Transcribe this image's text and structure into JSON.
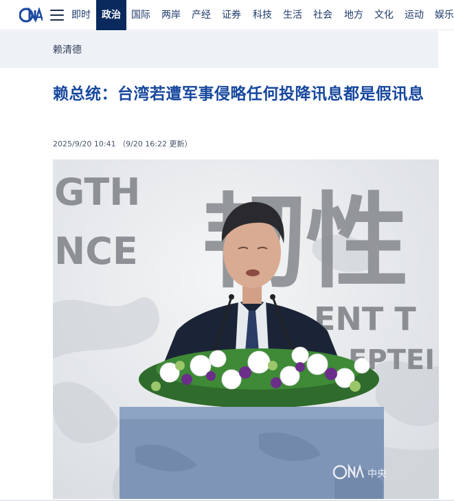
{
  "nav": {
    "items": [
      {
        "label": "即时"
      },
      {
        "label": "政治",
        "active": true
      },
      {
        "label": "国际"
      },
      {
        "label": "两岸"
      },
      {
        "label": "产经"
      },
      {
        "label": "证券"
      },
      {
        "label": "科技"
      },
      {
        "label": "生活"
      },
      {
        "label": "社会"
      },
      {
        "label": "地方"
      },
      {
        "label": "文化"
      },
      {
        "label": "运动"
      },
      {
        "label": "娱乐"
      }
    ]
  },
  "tag": {
    "label": "赖清德"
  },
  "article": {
    "title": "赖总统：台湾若遭军事侵略任何投降讯息都是假讯息",
    "published": "2025/9/20 10:41",
    "updated": "（9/20 16:22 更新）"
  },
  "photo": {
    "backdrop_left_text": [
      "GTH",
      "NCE"
    ],
    "backdrop_big_text": "韧性",
    "backdrop_sub_text": "ENT T",
    "backdrop_sub_text2": "EPTEI",
    "watermark": "中央"
  },
  "colors": {
    "nav_active_bg": "#0a2a5e",
    "title": "#17479e",
    "tag_bar_bg": "#eef1f6"
  }
}
